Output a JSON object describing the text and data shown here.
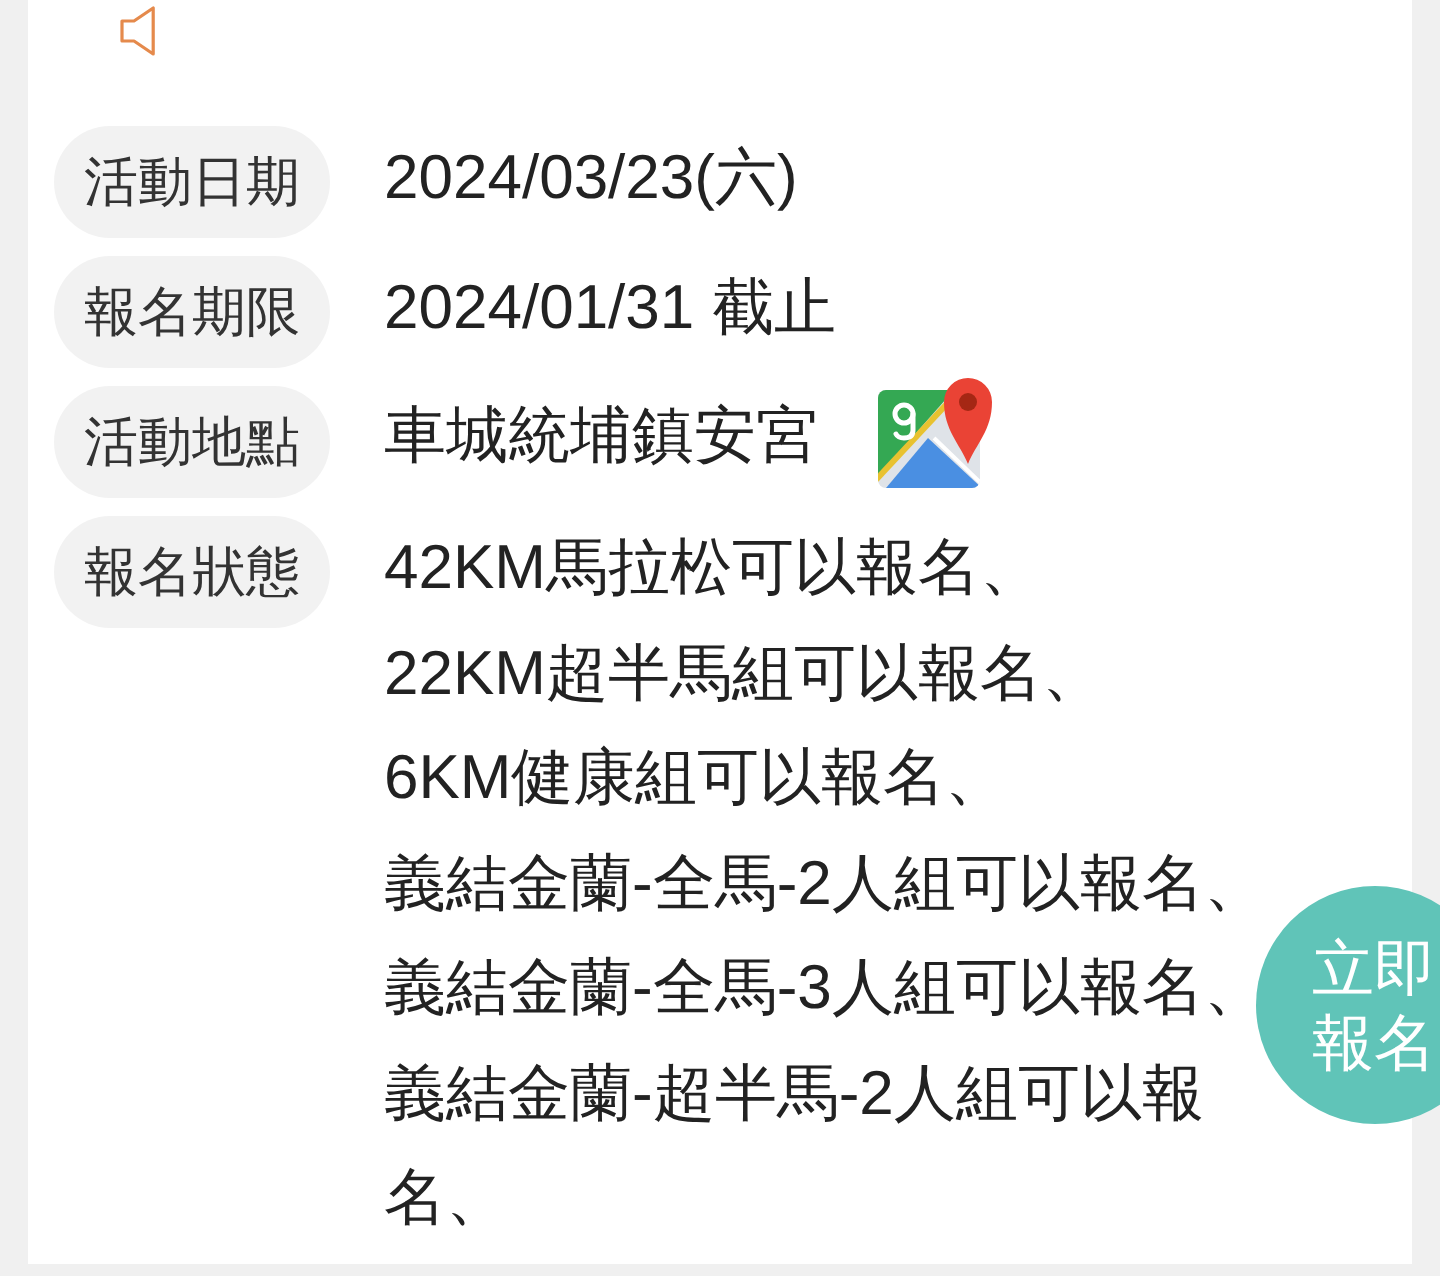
{
  "details": [
    {
      "kind": "text",
      "label": "活動日期",
      "value": "2024/03/23(六)"
    },
    {
      "kind": "text",
      "label": "報名期限",
      "value": "2024/01/31 截止"
    },
    {
      "kind": "location",
      "label": "活動地點",
      "value": "車城統埔鎮安宮"
    },
    {
      "kind": "list",
      "label": "報名狀態",
      "items": [
        "42KM馬拉松可以報名、",
        "22KM超半馬組可以報名、",
        "6KM健康組可以報名、",
        "義結金蘭-全馬-2人組可以報名、",
        "義結金蘭-全馬-3人組可以報名、",
        "義結金蘭-超半馬-2人組可以報名、"
      ]
    }
  ],
  "signup_button": {
    "label": "立即報名"
  }
}
